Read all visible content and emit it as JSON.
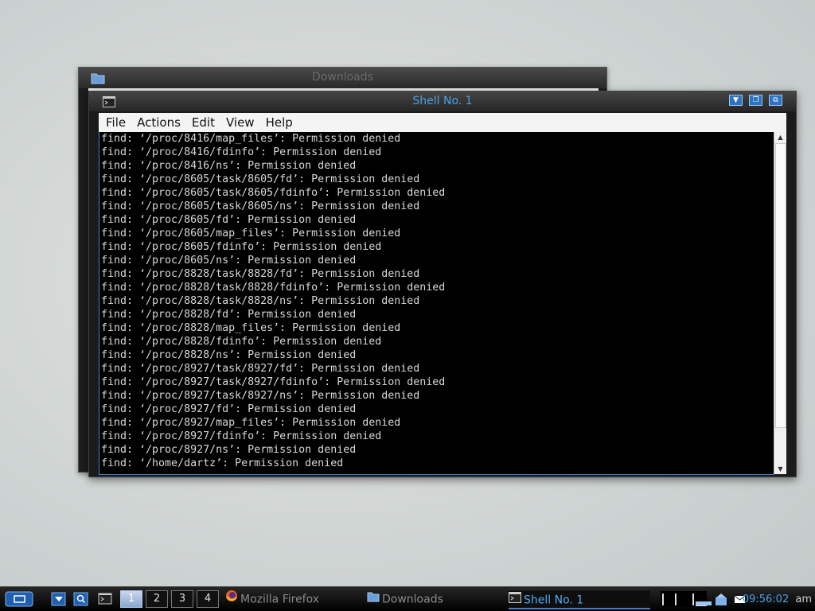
{
  "background_window": {
    "title": "Downloads"
  },
  "shell_window": {
    "title": "Shell No. 1",
    "menu": [
      "File",
      "Actions",
      "Edit",
      "View",
      "Help"
    ],
    "terminal_lines": [
      "find: ‘/proc/8416/map_files’: Permission denied",
      "find: ‘/proc/8416/fdinfo’: Permission denied",
      "find: ‘/proc/8416/ns’: Permission denied",
      "find: ‘/proc/8605/task/8605/fd’: Permission denied",
      "find: ‘/proc/8605/task/8605/fdinfo’: Permission denied",
      "find: ‘/proc/8605/task/8605/ns’: Permission denied",
      "find: ‘/proc/8605/fd’: Permission denied",
      "find: ‘/proc/8605/map_files’: Permission denied",
      "find: ‘/proc/8605/fdinfo’: Permission denied",
      "find: ‘/proc/8605/ns’: Permission denied",
      "find: ‘/proc/8828/task/8828/fd’: Permission denied",
      "find: ‘/proc/8828/task/8828/fdinfo’: Permission denied",
      "find: ‘/proc/8828/task/8828/ns’: Permission denied",
      "find: ‘/proc/8828/fd’: Permission denied",
      "find: ‘/proc/8828/map_files’: Permission denied",
      "find: ‘/proc/8828/fdinfo’: Permission denied",
      "find: ‘/proc/8828/ns’: Permission denied",
      "find: ‘/proc/8927/task/8927/fd’: Permission denied",
      "find: ‘/proc/8927/task/8927/fdinfo’: Permission denied",
      "find: ‘/proc/8927/task/8927/ns’: Permission denied",
      "find: ‘/proc/8927/fd’: Permission denied",
      "find: ‘/proc/8927/map_files’: Permission denied",
      "find: ‘/proc/8927/fdinfo’: Permission denied",
      "find: ‘/proc/8927/ns’: Permission denied",
      "find: ‘/home/dartz’: Permission denied"
    ],
    "titlebar_buttons": [
      "minimize-icon",
      "restore-icon",
      "maximize-icon"
    ]
  },
  "taskbar": {
    "desktops": [
      "1",
      "2",
      "3",
      "4"
    ],
    "active_desktop": "1",
    "tasks": [
      {
        "label": "Mozilla Firefox",
        "icon": "firefox-icon",
        "active": false
      },
      {
        "label": "Downloads",
        "icon": "folder-icon",
        "active": false
      },
      {
        "label": "Shell No. 1",
        "icon": "terminal-icon",
        "active": true
      }
    ],
    "clock": "09:56:02",
    "clock_suffix": "am"
  },
  "colors": {
    "accent": "#4aa0e6",
    "terminal_bg": "#000000",
    "terminal_fg": "#d8d8d8"
  }
}
